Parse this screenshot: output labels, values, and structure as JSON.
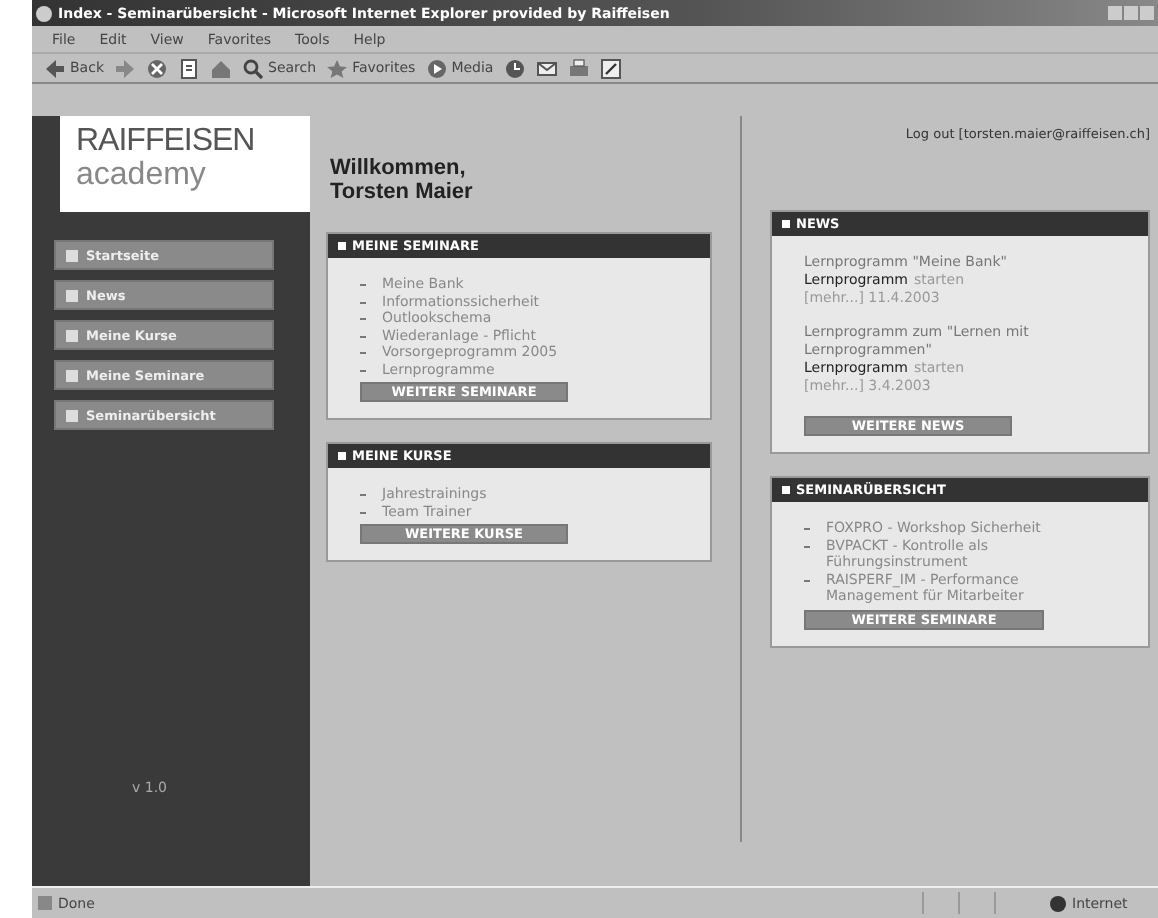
{
  "window": {
    "title": "Index - Seminarübersicht - Microsoft Internet Explorer provided by Raiffeisen"
  },
  "menu": [
    "File",
    "Edit",
    "View",
    "Favorites",
    "Tools",
    "Help"
  ],
  "toolbar": [
    {
      "kind": "back",
      "label": "Back"
    },
    {
      "kind": "forward"
    },
    {
      "kind": "stop"
    },
    {
      "kind": "refresh"
    },
    {
      "kind": "home"
    },
    {
      "kind": "search",
      "label": "Search"
    },
    {
      "kind": "favorites",
      "label": "Favorites"
    },
    {
      "kind": "media",
      "label": "Media"
    },
    {
      "kind": "history"
    },
    {
      "kind": "mail"
    },
    {
      "kind": "print"
    },
    {
      "kind": "edit"
    }
  ],
  "logo": {
    "line_1": "RAIFFEISEN",
    "line_2": "academy"
  },
  "sidebar": {
    "items": [
      {
        "label": "Startseite"
      },
      {
        "label": "News"
      },
      {
        "label": "Meine Kurse"
      },
      {
        "label": "Meine Seminare"
      },
      {
        "label": "Seminarübersicht"
      }
    ],
    "footer": "v 1.0"
  },
  "welcome": {
    "greeting": "Willkommen,",
    "name": "Torsten Maier"
  },
  "logout": "Log out [torsten.maier@raiffeisen.ch]",
  "left_panels": [
    {
      "title": "MEINE SEMINARE",
      "items": [
        "Meine Bank",
        "Informationssicherheit",
        "Outlookschema",
        "Wiederanlage - Pflicht",
        "Vorsorgeprogramm 2005",
        "Lernprogramme"
      ],
      "button": "WEITERE SEMINARE"
    },
    {
      "title": "MEINE KURSE",
      "items": [
        "Jahrestrainings",
        "Team Trainer"
      ],
      "button": "WEITERE KURSE"
    }
  ],
  "news": {
    "title": "NEWS",
    "entries": [
      {
        "headline": "Lernprogramm \"Meine Bank\"",
        "link": "Lernprogramm",
        "link_suffix": "starten",
        "more": "[mehr...] 11.4.2003"
      },
      {
        "headline": "Lernprogramm zum \"Lernen mit Lernprogrammen\"",
        "link": "Lernprogramm",
        "link_suffix": "starten",
        "more": "[mehr...] 3.4.2003"
      }
    ],
    "button": "WEITERE NEWS"
  },
  "overview": {
    "title": "SEMINARÜBERSICHT",
    "items": [
      "FOXPRO - Workshop Sicherheit",
      "BVPACKT - Kontrolle als Führungsinstrument",
      "RAISPERF_IM - Performance Management für Mitarbeiter"
    ],
    "button": "WEITERE SEMINARE"
  },
  "status_bar": {
    "text": "Done",
    "zone": "Internet"
  }
}
